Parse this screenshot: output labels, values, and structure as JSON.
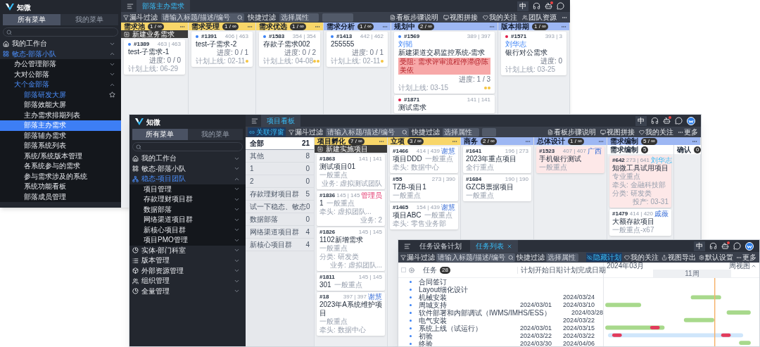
{
  "requirement_board": {
    "sidebar": {
      "brand": "知微",
      "tabs": [
        {
          "label": "所有菜单",
          "selected": true
        },
        {
          "label": "我的菜单",
          "selected": false
        }
      ],
      "menu": [
        {
          "label": "我的工作台",
          "kind": "home",
          "expanded": false
        },
        {
          "label": "敏态-部落小队",
          "kind": "grid",
          "expanded": true,
          "children": [
            {
              "label": "办公管理部落",
              "expanded": false
            },
            {
              "label": "大对公部落",
              "expanded": false
            },
            {
              "label": "大个金部落",
              "expanded": true,
              "children": [
                {
                  "label": "部落研发大屏",
                  "selected": false,
                  "hovered": true
                },
                {
                  "label": "部落效能大屏",
                  "selected": false,
                  "hovered": false
                },
                {
                  "label": "主办需求排期列表",
                  "selected": false,
                  "hovered": false
                },
                {
                  "label": "部落主办需求",
                  "selected": true,
                  "hovered": false
                },
                {
                  "label": "部落辅办需求",
                  "selected": false,
                  "hovered": false
                },
                {
                  "label": "部落系统列表",
                  "selected": false,
                  "hovered": false
                },
                {
                  "label": "系统/系统版本管理",
                  "selected": false,
                  "hovered": false
                },
                {
                  "label": "各系统参与的需求",
                  "selected": false,
                  "hovered": false
                },
                {
                  "label": "参与需求涉及的系统",
                  "selected": false,
                  "hovered": false
                },
                {
                  "label": "系统功能看板",
                  "selected": false,
                  "hovered": false
                },
                {
                  "label": "部落成员管理",
                  "selected": false,
                  "hovered": false
                }
              ]
            }
          ]
        }
      ]
    },
    "header": {
      "tabs": [
        {
          "label": "部落主办需求",
          "selected": true
        }
      ],
      "lang": "中",
      "notification": true
    },
    "toolbar": {
      "filter_button": "漏斗过滤",
      "search": {
        "placeholder": "请输入标题/描述/编号"
      },
      "quick_filter": "快捷过滤",
      "attribute_select": {
        "placeholder": "选择属性"
      },
      "actions": [
        {
          "label": "看板步骤说明",
          "kind": "steps",
          "selected": false
        },
        {
          "label": "视图拼接",
          "kind": "view",
          "selected": false
        },
        {
          "label": "我的关注",
          "kind": "follow",
          "selected": false
        },
        {
          "label": "团队资源",
          "kind": "team",
          "selected": false
        },
        {
          "kind": "more",
          "selected": false
        }
      ]
    },
    "columns": [
      {
        "title": "需求池",
        "count": "1 / ∞",
        "color": "#f8d669",
        "new_button": "新建业务需求",
        "cards": [
          {
            "id": "#1389",
            "counts": "463 | 463",
            "color": "#3b82f6",
            "title": "test-子需求-1",
            "progress": "进度: 0 / 0",
            "plan": "计划上线: 06-29"
          }
        ]
      },
      {
        "title": "需求受理",
        "count": "1 / ∞",
        "color": "#f8d669",
        "cards": [
          {
            "id": "#1391",
            "counts": "406 | 463",
            "color": "#3b82f6",
            "title": "test-子需求-2",
            "progress": "进度: 0 / 1",
            "plan": "计划上线: 02-11",
            "markers": [
              {
                "color": "#f5c542"
              }
            ]
          }
        ]
      },
      {
        "title": "需求优选",
        "count": "1 / ∞",
        "color": "#f8d669",
        "cards": [
          {
            "id": "#1583",
            "counts": "354 | 354",
            "color": "#3b82f6",
            "title": "存款子需求002",
            "progress": "进度: 0 / 2",
            "plan": "计划上线: 04-08",
            "markers": [
              {
                "color": "#f5c542"
              },
              {
                "color": "#f5c542"
              }
            ]
          }
        ]
      },
      {
        "title": "需求分析",
        "count": "1 / ∞",
        "color": "#9db7f3",
        "cards": [
          {
            "id": "#1413",
            "counts": "442 | 462",
            "color": "#3b82f6",
            "title": "255555",
            "progress": "进度: 0 / 1",
            "plan": "计划上线: 02-11",
            "markers": [
              {
                "color": "#f5c542"
              }
            ]
          }
        ]
      },
      {
        "title": "规划中",
        "count": "2 / ∞",
        "color": "#9db7f3",
        "cards": [
          {
            "id": "#1569",
            "counts": "389 | 397",
            "color": "#3b82f6",
            "owner": "刘韬",
            "title": "新建渠道交易监控系统-需求",
            "blocker": "受阻: 需求评审流程停滞@陈美依",
            "progress": "进度: 1 / 3",
            "plan": "计划上线: 03-15",
            "markers": [
              {
                "color": "#f5c542"
              },
              {
                "color": "#f5c542"
              }
            ]
          },
          {
            "id": "#1871",
            "counts": "141 | 141",
            "color": "#e11d48",
            "title": "测试需求"
          }
        ]
      },
      {
        "title": "版本排期",
        "count": "1 / ∞",
        "color": "#9db7f3",
        "cards": [
          {
            "id": "#1571",
            "counts": "393 | 3",
            "color": "#e11d48",
            "owner": "刘华志",
            "title": "银行对公需求",
            "progress": "进度: 0",
            "plan": "计划上线: 03-25"
          }
        ]
      }
    ]
  },
  "project_board": {
    "sidebar": {
      "brand": "知微",
      "tabs": [
        {
          "label": "所有菜单",
          "selected": true
        },
        {
          "label": "我的菜单",
          "selected": false
        }
      ],
      "menu": [
        {
          "label": "我的工作台",
          "kind": "home",
          "expanded": false
        },
        {
          "label": "敏态-部落小队",
          "kind": "grid",
          "expanded": false
        },
        {
          "label": "稳态-项目团队",
          "kind": "tree",
          "expanded": true,
          "children": [
            {
              "label": "项目管理",
              "expanded": false
            },
            {
              "label": "存款理财项目群",
              "expanded": false
            },
            {
              "label": "数据部落",
              "expanded": false
            },
            {
              "label": "网络渠道项目群",
              "expanded": false
            },
            {
              "label": "新核心项目群",
              "expanded": false
            },
            {
              "label": "项目PMO管理",
              "expanded": false
            }
          ]
        },
        {
          "label": "实体-部门科室",
          "kind": "entity",
          "expanded": false
        },
        {
          "label": "版本管理",
          "kind": "version",
          "expanded": false
        },
        {
          "label": "外部资源管理",
          "kind": "external",
          "expanded": false
        },
        {
          "label": "组织管理",
          "kind": "org",
          "expanded": false
        },
        {
          "label": "全量管理",
          "kind": "all",
          "expanded": false
        }
      ]
    },
    "header": {
      "tabs": [
        {
          "label": "项目看板",
          "selected": true
        }
      ],
      "lang": "中",
      "notification": true,
      "avatar": true
    },
    "toolbar": {
      "link_button": {
        "label": "关联浮窗",
        "selected": true
      },
      "filter_button": "漏斗过滤",
      "search": {
        "placeholder": "请输入标题/描述/编号"
      },
      "quick_filter": "快捷过滤",
      "attribute_select": {
        "placeholder": "选择属性"
      },
      "actions": [
        {
          "label": "看板步骤说明",
          "kind": "steps",
          "selected": false
        },
        {
          "label": "视图拼接",
          "kind": "view",
          "selected": false
        },
        {
          "label": "我的关注",
          "kind": "follow",
          "selected": false
        },
        {
          "label": "更多",
          "kind": "more",
          "selected": false
        }
      ]
    },
    "groups": [
      {
        "label": "全部",
        "count": "21",
        "selected": true
      },
      {
        "label": "其他",
        "count": "8",
        "selected": false
      },
      {
        "label": "1",
        "count": "0",
        "selected": false
      },
      {
        "label": "2",
        "count": "0",
        "selected": false
      },
      {
        "label": "存款理财项目群",
        "count": "5",
        "selected": false
      },
      {
        "label": "试一下稳态、敏态",
        "count": "0",
        "selected": false
      },
      {
        "label": "数据部落",
        "count": "0",
        "selected": false
      },
      {
        "label": "网络渠道项目群",
        "count": "4",
        "selected": false
      },
      {
        "label": "新核心项目群",
        "count": "4",
        "selected": false
      }
    ],
    "columns": [
      {
        "title": "项目孵化",
        "count": "7 / ∞",
        "color": "#f8d669",
        "new_button": "新建实施项目",
        "cards": [
          {
            "id": "#1863",
            "counts": "141 | 141",
            "title": "测试项目01",
            "tag": "一般重点",
            "footer_right": "业务: 虚拟测试团队",
            "tinted": false
          },
          {
            "id": "#1836",
            "counts": "145 | 145",
            "owner": {
              "name": "管理员",
              "kind": "admin"
            },
            "title": "1",
            "tag": "一般重点",
            "details": [
              "牵头: 虚拟团队..."
            ],
            "footer_right": "业务: 2",
            "tinted": false
          },
          {
            "id": "#1826",
            "counts": "145 | 145",
            "title": "1102新增需求",
            "tag": "一般重点",
            "details": [
              "分类: 研发类"
            ],
            "footer_right": "业务: 虚拟团队...",
            "tinted": false
          },
          {
            "id": "#1811",
            "counts": "145 | 145",
            "title": "301",
            "tag": "一般重点",
            "tinted": false
          },
          {
            "id": "#18",
            "counts": "397 | 397",
            "owner": {
              "name": "谢慧",
              "kind": "member"
            },
            "title": "2023年A系统维护项目",
            "tag": "一般重点",
            "details": [
              "牵头: 数据中心"
            ],
            "tinted": false
          }
        ]
      },
      {
        "title": "立项",
        "count": "3 / ∞",
        "color": "#f8d669",
        "cards": [
          {
            "id": "#1466",
            "counts": "414 | 439",
            "owner": {
              "name": "谢慧",
              "kind": "member"
            },
            "title": "项目DDD",
            "tag": "一般重点",
            "details": [
              "牵头: 数据中心"
            ],
            "tinted": false
          },
          {
            "id": "#55",
            "counts": "273 | 390",
            "title": "TZB-项目1",
            "tag": "一般重点",
            "tinted": false
          },
          {
            "id": "#1465",
            "counts": "154 | 439",
            "owner": {
              "name": "谢慧",
              "kind": "member"
            },
            "title": "项目ABC",
            "tag": "一般重点",
            "details": [
              "牵头: 零售业务部"
            ],
            "tinted": false
          }
        ]
      },
      {
        "title": "商务",
        "count": "2 / ∞",
        "color": "#9db7f3",
        "cards": [
          {
            "id": "#1641",
            "counts": "196 | 273",
            "title": "2023年重点项目",
            "tag": "全行重点",
            "tinted": false
          },
          {
            "id": "#1684",
            "counts": "190 | 190",
            "title": "GZCB票据项目",
            "tag": "一般重点",
            "tinted": false
          }
        ]
      },
      {
        "title": "总体设计",
        "count": "1 / ∞",
        "color": "#9db7f3",
        "cards": [
          {
            "id": "#1523",
            "counts": "407 | 407",
            "owner": {
              "name": "广西",
              "kind": "member"
            },
            "title": "手机银行测试",
            "tag": "一般重点",
            "tinted": true
          }
        ]
      },
      {
        "title": "需求编制",
        "count": "5 / ∞",
        "color": "#9db7f3",
        "subcolumns": [
          {
            "title": "需求编制",
            "count": "5",
            "cards": [
              {
                "id": "#642",
                "counts": "273 | 641",
                "owner": {
                  "name": "刘华志",
                  "kind": "lead"
                },
                "title": "知微工具试用项目",
                "tag": "专业重点",
                "details": [
                  "牵头: 金融科技部",
                  "分类: 研发类"
                ],
                "footer_right": "投产: 03-31",
                "tinted": true
              },
              {
                "id": "#1479",
                "counts": "414 | 420",
                "owner": {
                  "name": "戚薇",
                  "kind": "member"
                },
                "title": "大额存款项目",
                "tag": "一般重点-x67",
                "tinted": false
              }
            ]
          },
          {
            "title": "确认",
            "count": "0"
          }
        ]
      }
    ]
  },
  "task_plan": {
    "header": {
      "tabs": [
        {
          "label": "任务设备计划",
          "selected": false,
          "closable": false
        },
        {
          "label": "任务列表",
          "selected": true,
          "closable": true
        }
      ],
      "lang": "中",
      "notification": true,
      "avatar": true
    },
    "toolbar": {
      "filter_button": "漏斗过滤",
      "search": {
        "placeholder": "请输入标题/描述/编号"
      },
      "quick_filter": "快捷过滤",
      "attribute_select": {
        "placeholder": "选择属性"
      },
      "actions": [
        {
          "label": "隐藏计划",
          "kind": "hide",
          "selected": true
        },
        {
          "label": "我的关注",
          "kind": "follow",
          "selected": false
        },
        {
          "label": "视图导出",
          "kind": "export",
          "selected": false
        },
        {
          "label": "默认设置",
          "kind": "settings",
          "selected": false
        },
        {
          "label": "更多",
          "kind": "more",
          "selected": false
        }
      ]
    },
    "table": {
      "select_all": {
        "checked": false
      },
      "task_label": "任务",
      "task_count": "28",
      "start_label": "计划开始日期",
      "end_label": "计划完成日期",
      "rows": [
        {
          "name": "合同签订"
        },
        {
          "name": "Layout细化设计"
        },
        {
          "name": "机械安装",
          "end": "2024/03/24"
        },
        {
          "name": "周城支持",
          "start": "2024/03/01",
          "end": "2024/03/10"
        },
        {
          "name": "软件部署和内部调试（IWMS/IMHS/ESS）",
          "end": "2024/03/28"
        },
        {
          "name": "电气安装",
          "end": "2024/03/22"
        },
        {
          "name": "系统上线（试运行）",
          "start": "2024/03/01",
          "end": "2024/03/15"
        },
        {
          "name": "初验",
          "start": "2024/03/22",
          "end": "2024/03/22"
        },
        {
          "name": "终验",
          "start": "2024/03/30",
          "end": "2024/04/06"
        }
      ]
    },
    "gantt": {
      "month": "2024年03月",
      "view_button": "周视图",
      "week": "11周"
    }
  }
}
